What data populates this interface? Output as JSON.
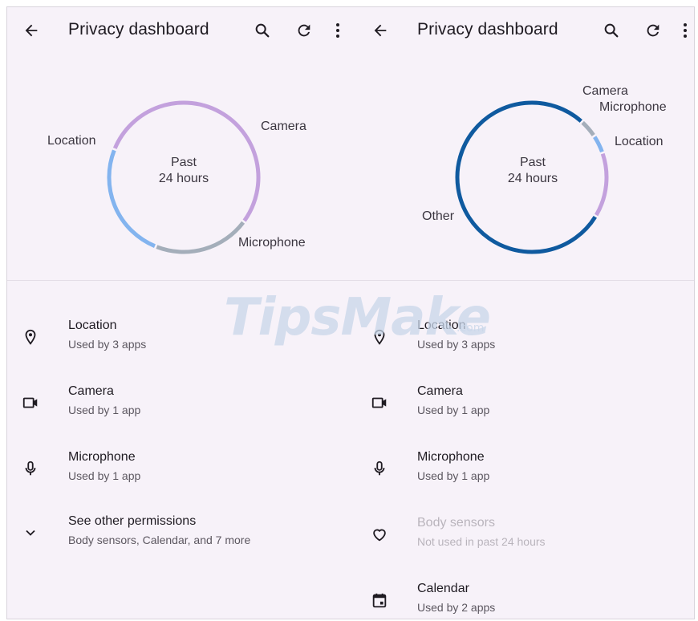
{
  "left": {
    "header": {
      "title": "Privacy dashboard",
      "back_icon": "arrow-left-icon",
      "search_icon": "search-icon",
      "refresh_icon": "refresh-icon",
      "more_icon": "more-vert-icon"
    },
    "chart": {
      "center_line1": "Past",
      "center_line2": "24 hours",
      "segments": [
        {
          "label": "Location",
          "color": "#c3a1dd",
          "fraction": 0.54
        },
        {
          "label": "Camera",
          "color": "#a4aeba",
          "fraction": 0.21
        },
        {
          "label": "Microphone",
          "color": "#83b4ef",
          "fraction": 0.25
        }
      ]
    },
    "permissions": [
      {
        "icon": "location-pin-icon",
        "title": "Location",
        "subtitle": "Used by 3 apps"
      },
      {
        "icon": "camera-icon",
        "title": "Camera",
        "subtitle": "Used by 1 app"
      },
      {
        "icon": "microphone-icon",
        "title": "Microphone",
        "subtitle": "Used by 1 app"
      },
      {
        "icon": "chevron-down-icon",
        "title": "See other permissions",
        "subtitle": "Body sensors, Calendar, and 7 more"
      }
    ]
  },
  "right": {
    "header": {
      "title": "Privacy dashboard",
      "back_icon": "arrow-left-icon",
      "search_icon": "search-icon",
      "refresh_icon": "refresh-icon",
      "more_icon": "more-vert-icon"
    },
    "chart": {
      "center_line1": "Past",
      "center_line2": "24 hours",
      "segments": [
        {
          "label": "Camera",
          "color": "#a4aeba",
          "fraction": 0.04
        },
        {
          "label": "Microphone",
          "color": "#83b4ef",
          "fraction": 0.04
        },
        {
          "label": "Location",
          "color": "#c3a1dd",
          "fraction": 0.14
        },
        {
          "label": "Other",
          "color": "#0f5a9f",
          "fraction": 0.78
        }
      ]
    },
    "permissions": [
      {
        "icon": "location-pin-icon",
        "title": "Location",
        "subtitle": "Used by 3 apps"
      },
      {
        "icon": "camera-icon",
        "title": "Camera",
        "subtitle": "Used by 1 app"
      },
      {
        "icon": "microphone-icon",
        "title": "Microphone",
        "subtitle": "Used by 1 app"
      },
      {
        "icon": "heart-icon",
        "title": "Body sensors",
        "subtitle": "Not used in past 24 hours"
      },
      {
        "icon": "calendar-icon",
        "title": "Calendar",
        "subtitle": "Used by 2 apps"
      }
    ]
  },
  "watermark": {
    "text": "TipsMake",
    "suffix": ".com"
  }
}
